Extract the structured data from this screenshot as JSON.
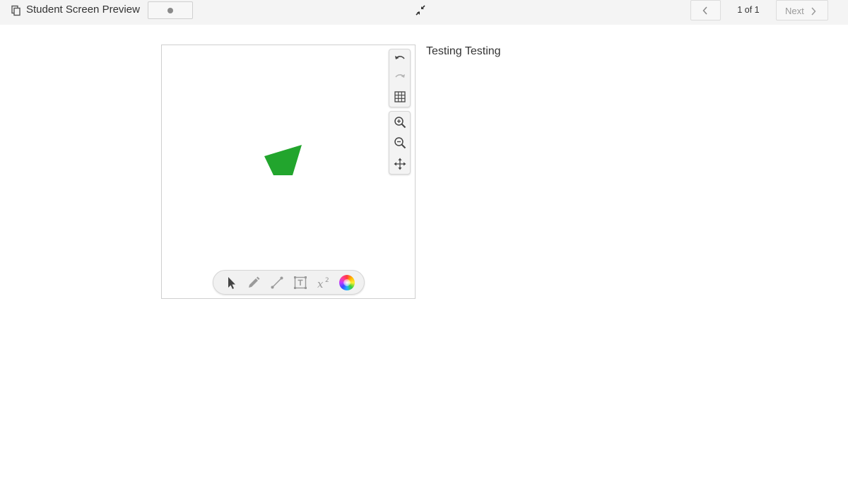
{
  "header": {
    "title": "Student Screen Preview",
    "copy_icon": "copy-icon",
    "status_icon": "dot-icon",
    "collapse_icon": "collapse-arrows-icon",
    "prev_icon": "chevron-left-icon",
    "page_indicator": "1 of 1",
    "next_label": "Next",
    "next_icon": "chevron-right-icon"
  },
  "canvas": {
    "shape_color": "#22a52d",
    "side_tools": [
      {
        "name": "undo",
        "icon": "undo-icon",
        "enabled": true
      },
      {
        "name": "redo",
        "icon": "redo-icon",
        "enabled": false
      },
      {
        "name": "grid",
        "icon": "grid-icon",
        "enabled": true
      },
      {
        "name": "zoom-in",
        "icon": "zoom-in-icon",
        "enabled": true
      },
      {
        "name": "zoom-out",
        "icon": "zoom-out-icon",
        "enabled": true
      },
      {
        "name": "pan",
        "icon": "move-icon",
        "enabled": true
      }
    ],
    "bottom_tools": [
      {
        "name": "select",
        "icon": "pointer-icon"
      },
      {
        "name": "pen",
        "icon": "pencil-icon"
      },
      {
        "name": "line",
        "icon": "line-icon"
      },
      {
        "name": "text",
        "icon": "text-box-icon"
      },
      {
        "name": "math",
        "icon": "superscript-icon",
        "label": "x",
        "superscript": "2"
      },
      {
        "name": "color",
        "icon": "color-wheel-icon"
      }
    ]
  },
  "prompt": {
    "text": "Testing Testing"
  }
}
